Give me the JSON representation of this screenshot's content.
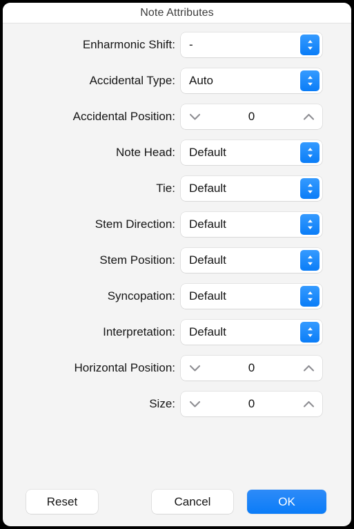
{
  "window": {
    "title": "Note Attributes",
    "background_color": "#f4f4f4",
    "titlebar_color": "#ffffff",
    "accent_color": "#0a7cf8"
  },
  "rows": [
    {
      "label": "Enharmonic Shift:",
      "type": "popup",
      "value": "-"
    },
    {
      "label": "Accidental Type:",
      "type": "popup",
      "value": "Auto"
    },
    {
      "label": "Accidental Position:",
      "type": "stepper",
      "value": "0"
    },
    {
      "label": "Note Head:",
      "type": "popup",
      "value": "Default"
    },
    {
      "label": "Tie:",
      "type": "popup",
      "value": "Default"
    },
    {
      "label": "Stem Direction:",
      "type": "popup",
      "value": "Default"
    },
    {
      "label": "Stem Position:",
      "type": "popup",
      "value": "Default"
    },
    {
      "label": "Syncopation:",
      "type": "popup",
      "value": "Default"
    },
    {
      "label": "Interpretation:",
      "type": "popup",
      "value": "Default"
    },
    {
      "label": "Horizontal Position:",
      "type": "stepper",
      "value": "0"
    },
    {
      "label": "Size:",
      "type": "stepper",
      "value": "0"
    }
  ],
  "footer": {
    "reset_label": "Reset",
    "cancel_label": "Cancel",
    "ok_label": "OK"
  },
  "icons": {
    "popup_badge": "chevron-up-down-icon",
    "stepper_decrement": "chevron-down-icon",
    "stepper_increment": "chevron-up-icon"
  }
}
